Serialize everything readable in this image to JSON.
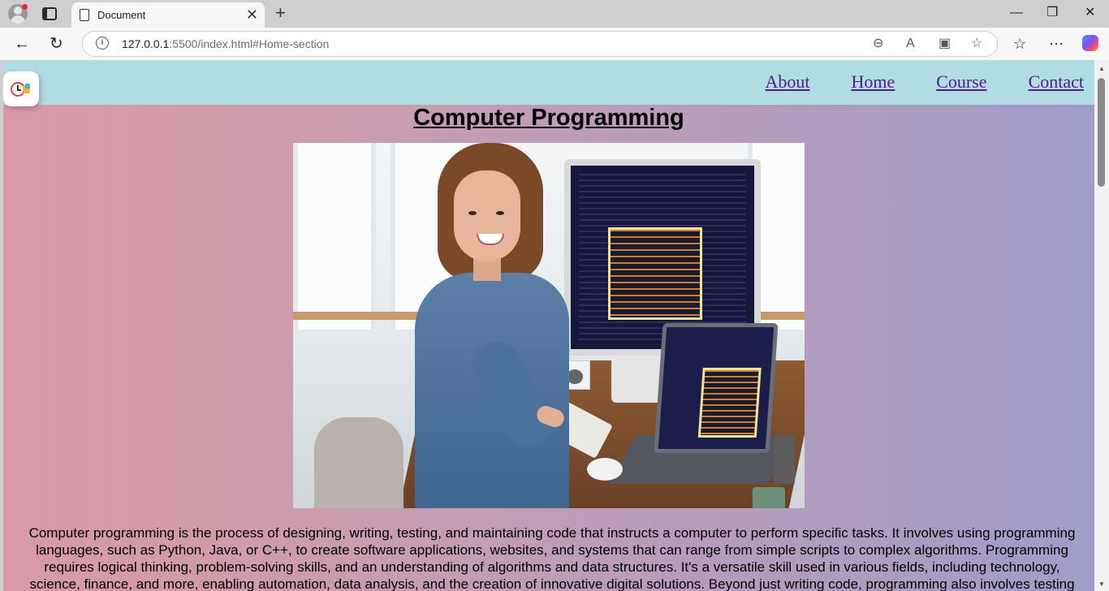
{
  "browser": {
    "tab_title": "Document",
    "tab_close": "✕",
    "new_tab": "+",
    "url_host": "127.0.0.1",
    "url_rest": ":5500/index.html#Home-section",
    "window_controls": {
      "minimize": "—",
      "restore": "❐",
      "close": "✕"
    },
    "icons": [
      "profile-icon",
      "tab-actions-icon",
      "document-icon",
      "back-icon",
      "refresh-icon",
      "site-info-icon",
      "zoom-out-icon",
      "read-aloud-icon",
      "split-screen-icon",
      "favorite-star-icon",
      "favorites-icon",
      "more-icon",
      "copilot-icon"
    ]
  },
  "nav": {
    "links": [
      "About",
      "Home",
      "Course",
      "Contact"
    ],
    "link_color": "#551a8b",
    "bar_color": "#b0dde4"
  },
  "main": {
    "heading": "Computer Programming",
    "image_alt": "Woman smiling at a desk with a desktop monitor and laptop showing code",
    "paragraph": "Computer programming is the process of designing, writing, testing, and maintaining code that instructs a computer to perform specific tasks. It involves using programming languages, such as Python, Java, or C++, to create software applications, websites, and systems that can range from simple scripts to complex algorithms. Programming requires logical thinking, problem-solving skills, and an understanding of algorithms and data structures. It's a versatile skill used in various fields, including technology, science, finance, and more, enabling automation, data analysis, and the creation of innovative digital solutions. Beyond just writing code, programming also involves testing"
  },
  "colors": {
    "gradient_start": "#d99aa4",
    "gradient_end": "#a09cc9"
  }
}
